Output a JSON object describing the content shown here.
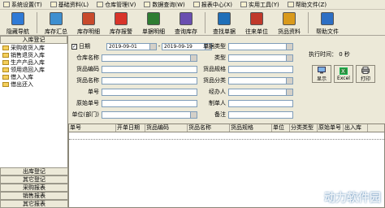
{
  "menu": [
    {
      "label": "系统设置(T)"
    },
    {
      "label": "基础资料(L)"
    },
    {
      "label": "仓库管理(V)"
    },
    {
      "label": "数据查询(W)"
    },
    {
      "label": "报表中心(X)"
    },
    {
      "label": "实用工具(Y)"
    },
    {
      "label": "帮助文件(Z)"
    }
  ],
  "toolbar": [
    {
      "label": "隐藏导航",
      "icon": "nav-hide-icon",
      "color": "#2f7ad6"
    },
    {
      "label": "库存汇总",
      "icon": "summary-icon",
      "color": "#3e8fd0"
    },
    {
      "label": "库存明细",
      "icon": "detail-icon",
      "color": "#c84a2c"
    },
    {
      "label": "库存报警",
      "icon": "alarm-icon",
      "color": "#d8342a"
    },
    {
      "label": "单据明细",
      "icon": "doc-detail-icon",
      "color": "#2e7d32"
    },
    {
      "label": "查询库存",
      "icon": "query-icon",
      "color": "#6a4fb0"
    },
    {
      "label": "查找单据",
      "icon": "find-icon",
      "color": "#1f6fb8"
    },
    {
      "label": "往来单位",
      "icon": "partner-icon",
      "color": "#c0392b"
    },
    {
      "label": "货品资料",
      "icon": "goods-icon",
      "color": "#d99a1c"
    },
    {
      "label": "帮助文件",
      "icon": "help-icon",
      "color": "#2d6fc4"
    }
  ],
  "sidebar": {
    "header": "入库登记",
    "items": [
      "采购收货入库",
      "销售退货入库",
      "生产产品入库",
      "领用退回入库",
      "借入入库",
      "借出还入"
    ],
    "bottom": [
      "出库登记",
      "其它登记",
      "采购报表",
      "销售报表",
      "其它报表"
    ]
  },
  "form": {
    "date_label": "日期",
    "date_checked": "✓",
    "date_from": "2019-09-01",
    "date_to": "2019-09-19",
    "warehouse": "仓库名称",
    "goods_code": "货品编码",
    "goods_name": "货品名称",
    "doc_no": "单号",
    "origin_no": "原始单号",
    "unit_dept": "单位(部门)",
    "doc_type": "单据类型",
    "type": "类型",
    "goods_spec": "货品规格",
    "goods_class": "货品分类",
    "handler": "经办人",
    "maker": "制单人",
    "remark": "备注",
    "exec_time": "执行时间： 0 秒"
  },
  "buttons": {
    "show": "显示",
    "excel": "Excel",
    "print": "打印"
  },
  "grid": {
    "columns": [
      "单号",
      "开单日期",
      "货品编码",
      "货品名称",
      "货品规格",
      "单位",
      "分类类型",
      "原始单号",
      "出入库"
    ]
  },
  "watermark": "动力软件园"
}
